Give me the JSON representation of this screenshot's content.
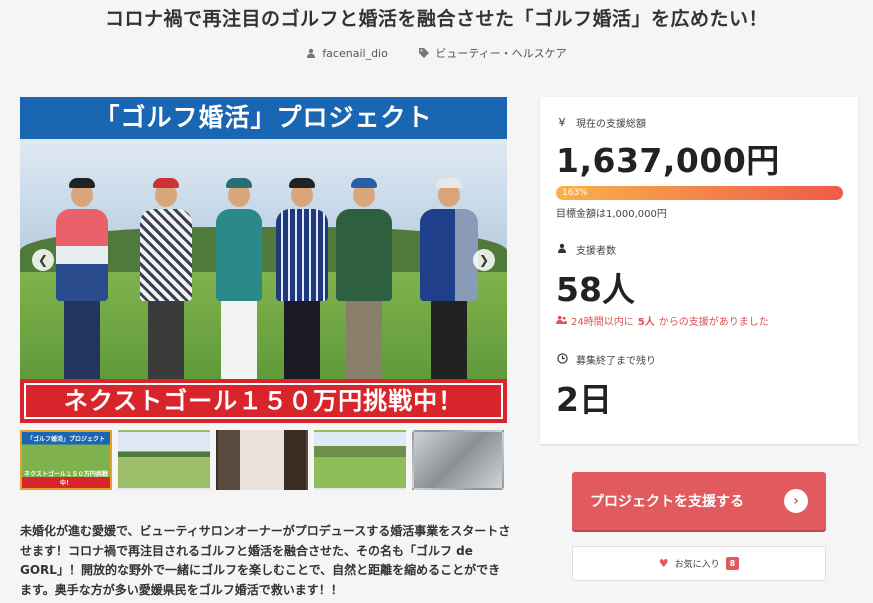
{
  "project": {
    "title": "コロナ禍で再注目のゴルフと婚活を融合させた「ゴルフ婚活」を広めたい！",
    "author": "facenail_dio",
    "category": "ビューティー・ヘルスケア"
  },
  "main_image": {
    "banner_top": "「ゴルフ婚活」プロジェクト",
    "banner_bottom": "ネクストゴール１５０万円挑戦中！",
    "prev_icon": "chevron-left-icon",
    "next_icon": "chevron-right-icon"
  },
  "thumbnails": [
    {
      "label_top": "「ゴルフ婚活」プロジェクト",
      "label_bottom": "ネクストゴール１５０万円挑戦中！",
      "active": true
    },
    {
      "active": false
    },
    {
      "active": false
    },
    {
      "active": false
    },
    {
      "active": false
    }
  ],
  "stats": {
    "total_label": "現在の支援総額",
    "total_icon": "yen-icon",
    "total_amount": "1,637,000円",
    "progress_text": "163%",
    "progress_percent": 163,
    "goal_text": "目標金額は1,000,000円",
    "supporters_label": "支援者数",
    "supporters_icon": "user-icon",
    "supporters_count": "58人",
    "recent_prefix": "24時間以内に",
    "recent_count": "5人",
    "recent_suffix": "からの支援がありました",
    "remaining_label": "募集終了まで残り",
    "remaining_icon": "clock-icon",
    "remaining_days": "2日"
  },
  "actions": {
    "support_label": "プロジェクトを支援する",
    "favorite_label": "お気に入り",
    "favorite_count": "8"
  },
  "description": "未婚化が進む愛媛で、ビューティサロンオーナーがプロデュースする婚活事業をスタートさせます！コロナ禍で再注目されるゴルフと婚活を融合させた、その名も「ゴルフ de GORL」！開放的な野外で一緒にゴルフを楽しむことで、自然と距離を縮めることができます。奥手な方が多い愛媛県民をゴルフ婚活で救います！！",
  "colors": {
    "accent": "#e05a5e",
    "banner_blue": "#1a66b3",
    "banner_red": "#d8252b"
  }
}
